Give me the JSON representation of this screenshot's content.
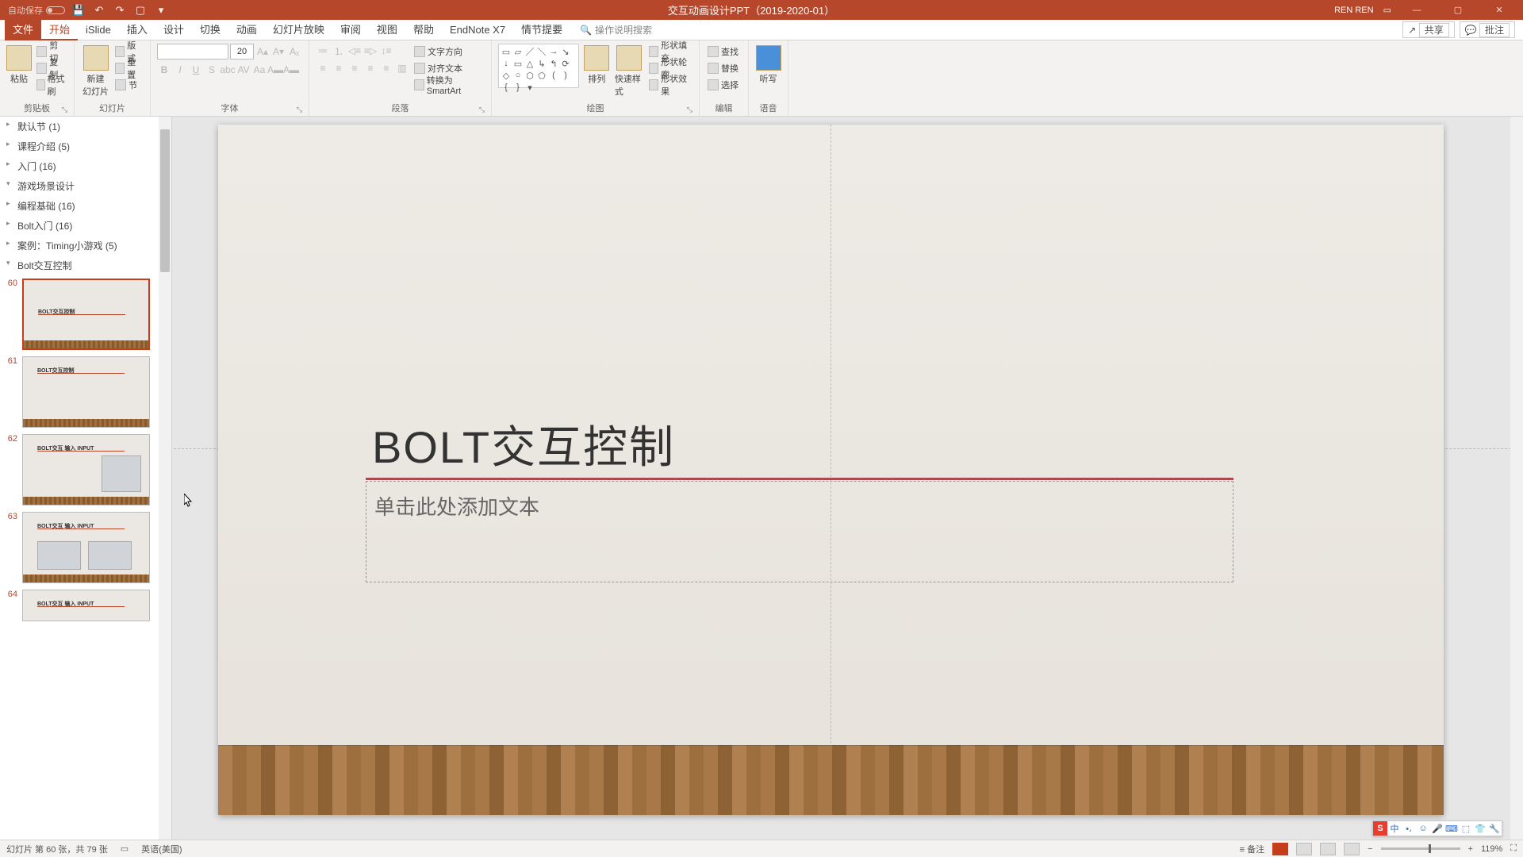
{
  "titlebar": {
    "autosave_label": "自动保存",
    "doc_title": "交互动画设计PPT（2019-2020-01）",
    "user": "REN REN"
  },
  "menu": {
    "file": "文件",
    "tabs": [
      "开始",
      "iSlide",
      "插入",
      "设计",
      "切换",
      "动画",
      "幻灯片放映",
      "审阅",
      "视图",
      "帮助",
      "EndNote X7",
      "情节提要"
    ],
    "active_index": 0,
    "search_placeholder": "操作说明搜索",
    "share": "共享",
    "comment": "批注"
  },
  "ribbon": {
    "clipboard": {
      "label": "剪贴板",
      "paste": "粘贴",
      "cut": "剪切",
      "copy": "复制",
      "painter": "格式刷"
    },
    "slides": {
      "label": "幻灯片",
      "new": "新建\n幻灯片",
      "layout": "版式",
      "reset": "重置",
      "section": "节"
    },
    "font": {
      "label": "字体",
      "size": "20"
    },
    "paragraph": {
      "label": "段落",
      "textdir": "文字方向",
      "align": "对齐文本",
      "smartart": "转换为 SmartArt"
    },
    "drawing": {
      "label": "绘图",
      "arrange": "排列",
      "quickstyle": "快速样式",
      "fill": "形状填充",
      "outline": "形状轮廓",
      "effect": "形状效果"
    },
    "editing": {
      "label": "编辑",
      "find": "查找",
      "replace": "替换",
      "select": "选择"
    },
    "voice": {
      "label": "语音",
      "dictate": "听写"
    }
  },
  "sections": [
    {
      "label": "默认节 (1)",
      "expanded": false
    },
    {
      "label": "课程介绍 (5)",
      "expanded": false
    },
    {
      "label": "入门 (16)",
      "expanded": false
    },
    {
      "label": "游戏场景设计",
      "expanded": true
    },
    {
      "label": "编程基础 (16)",
      "expanded": false
    },
    {
      "label": "Bolt入门 (16)",
      "expanded": false
    },
    {
      "label": "案例：Timing小游戏 (5)",
      "expanded": false
    },
    {
      "label": "Bolt交互控制",
      "expanded": true
    }
  ],
  "thumbs": [
    {
      "num": "60",
      "title": "BOLT交互控制",
      "selected": true
    },
    {
      "num": "61",
      "title": "BOLT交互控制",
      "selected": false
    },
    {
      "num": "62",
      "title": "BOLT交互 输入 INPUT",
      "selected": false
    },
    {
      "num": "63",
      "title": "BOLT交互 输入 INPUT",
      "selected": false
    },
    {
      "num": "64",
      "title": "BOLT交互 输入 INPUT",
      "selected": false
    }
  ],
  "slide": {
    "title_prefix": "BOLT",
    "title_suffix": "交互控制",
    "subtitle_placeholder": "单击此处添加文本"
  },
  "statusbar": {
    "slide_info": "幻灯片 第 60 张，共 79 张",
    "lang": "英语(美国)",
    "notes": "备注",
    "zoom": "119%"
  },
  "ime": {
    "s": "S",
    "zh": "中"
  }
}
